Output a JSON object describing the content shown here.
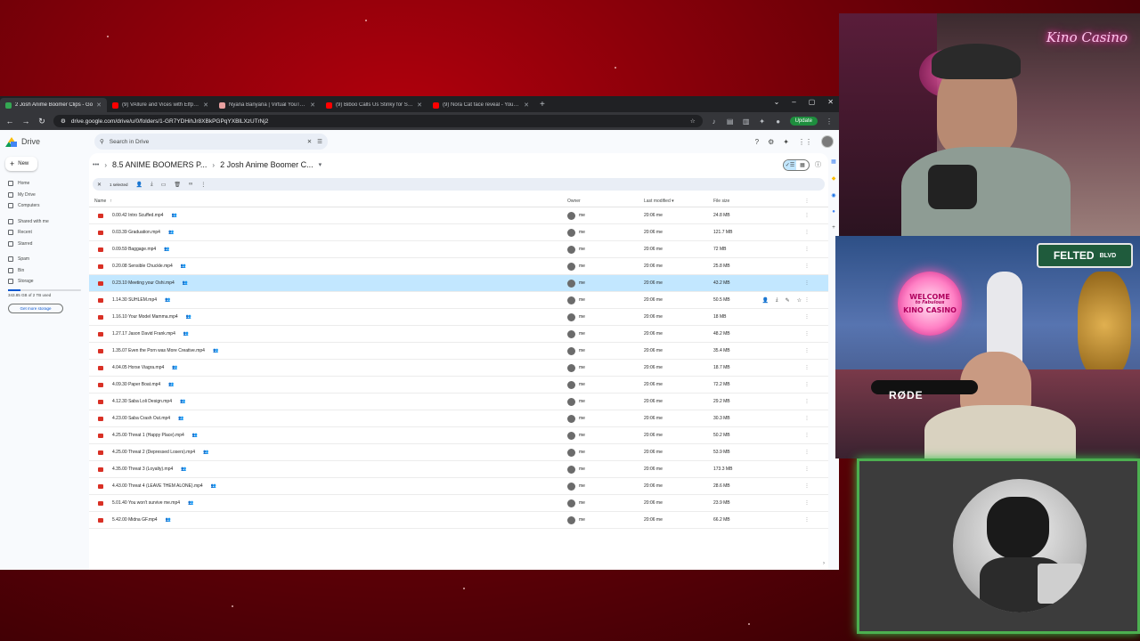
{
  "browser": {
    "tabs": [
      {
        "title": "2 Josh Anime Boomer Clips - Go",
        "active": true,
        "color": "#34a853"
      },
      {
        "title": "(9) VAllure and Vices with Elfpire Ext",
        "active": false,
        "color": "#ff0000"
      },
      {
        "title": "Nyana Banyana | Virtual YouTuber W",
        "active": false,
        "color": "#e8a0a0"
      },
      {
        "title": "(9) Biboo Calls Us Stinky for Some St",
        "active": false,
        "color": "#ff0000"
      },
      {
        "title": "(9) Nora Cat face reveal - YouTube",
        "active": false,
        "color": "#ff0000"
      }
    ],
    "url": "drive.google.com/drive/u/0/folders/1-GR7YDHihJr8XBkPGPqYXBlLXzUTrNj2",
    "update_label": "Update"
  },
  "drive": {
    "logo_text": "Drive",
    "search_placeholder": "Search in Drive",
    "new_label": "New",
    "nav_primary": [
      "Home",
      "My Drive",
      "Computers"
    ],
    "nav_secondary": [
      "Shared with me",
      "Recent",
      "Starred"
    ],
    "nav_tertiary": [
      "Spam",
      "Bin",
      "Storage"
    ],
    "storage_used": "343.85 GB of 2 TB used",
    "storage_fraction": 0.17,
    "get_storage_label": "Get more storage",
    "breadcrumb": [
      "8.5 ANIME BOOMERS P...",
      "2 Josh Anime Boomer C..."
    ],
    "selection_text": "1 selected",
    "columns": {
      "name": "Name",
      "owner": "Owner",
      "modified": "Last modified",
      "size": "File size"
    },
    "files": [
      {
        "name": "0.00.42 Intro Scuffed.mp4",
        "owner": "me",
        "modified": "20:06 me",
        "size": "24.8 MB",
        "selected": false
      },
      {
        "name": "0.03.39 Graduation.mp4",
        "owner": "me",
        "modified": "20:06 me",
        "size": "121.7 MB",
        "selected": false
      },
      {
        "name": "0.09.59 Baggage.mp4",
        "owner": "me",
        "modified": "20:06 me",
        "size": "72 MB",
        "selected": false
      },
      {
        "name": "0.20.08 Sensible Chuckle.mp4",
        "owner": "me",
        "modified": "20:06 me",
        "size": "25.8 MB",
        "selected": false
      },
      {
        "name": "0.23.10 Meeting your Oshi.mp4",
        "owner": "me",
        "modified": "20:06 me",
        "size": "43.2 MB",
        "selected": true
      },
      {
        "name": "1.14.30 SUHLEM.mp4",
        "owner": "me",
        "modified": "20:06 me",
        "size": "50.5 MB",
        "selected": false
      },
      {
        "name": "1.16.10 Your Model Mamma.mp4",
        "owner": "me",
        "modified": "20:06 me",
        "size": "18 MB",
        "selected": false
      },
      {
        "name": "1.27.17 Jason David Frank.mp4",
        "owner": "me",
        "modified": "20:06 me",
        "size": "48.2 MB",
        "selected": false
      },
      {
        "name": "1.35.07 Even the Porn was More Creative.mp4",
        "owner": "me",
        "modified": "20:06 me",
        "size": "35.4 MB",
        "selected": false
      },
      {
        "name": "4.04.05 Horse Viagra.mp4",
        "owner": "me",
        "modified": "20:06 me",
        "size": "18.7 MB",
        "selected": false
      },
      {
        "name": "4.09.30 Paper Boat.mp4",
        "owner": "me",
        "modified": "20:06 me",
        "size": "72.2 MB",
        "selected": false
      },
      {
        "name": "4.12.30 Saba Loli Design.mp4",
        "owner": "me",
        "modified": "20:06 me",
        "size": "29.2 MB",
        "selected": false
      },
      {
        "name": "4.23.00 Saba Crash Out.mp4",
        "owner": "me",
        "modified": "20:06 me",
        "size": "30.3 MB",
        "selected": false
      },
      {
        "name": "4.25.00 Threat 1 (Happy Place).mp4",
        "owner": "me",
        "modified": "20:06 me",
        "size": "50.2 MB",
        "selected": false
      },
      {
        "name": "4.25.00 Threat 2 (Depressed Losers).mp4",
        "owner": "me",
        "modified": "20:06 me",
        "size": "53.9 MB",
        "selected": false
      },
      {
        "name": "4.35.00 Threat 3 (Loyalty).mp4",
        "owner": "me",
        "modified": "20:06 me",
        "size": "173.3 MB",
        "selected": false
      },
      {
        "name": "4.43.00 Threat 4 (LEAVE THEM ALONE).mp4",
        "owner": "me",
        "modified": "20:06 me",
        "size": "28.6 MB",
        "selected": false
      },
      {
        "name": "5.01.40 You won't survive me.mp4",
        "owner": "me",
        "modified": "20:06 me",
        "size": "23.9 MB",
        "selected": false
      },
      {
        "name": "5.42.00 Midna GF.mp4",
        "owner": "me",
        "modified": "20:06 me",
        "size": "66.2 MB",
        "selected": false
      }
    ]
  },
  "stream": {
    "brand": "Kino Casino",
    "sign_line1": "WELCOME",
    "sign_line2": "to Fabulous",
    "sign_line3": "KINO CASINO",
    "street_sign": "FELTED",
    "street_sign_suffix": "BLVD",
    "mic_brand": "RØDE"
  },
  "colors": {
    "accent": "#0b57d0",
    "selected_row": "#c2e7ff",
    "frame_green": "#4caf50"
  }
}
